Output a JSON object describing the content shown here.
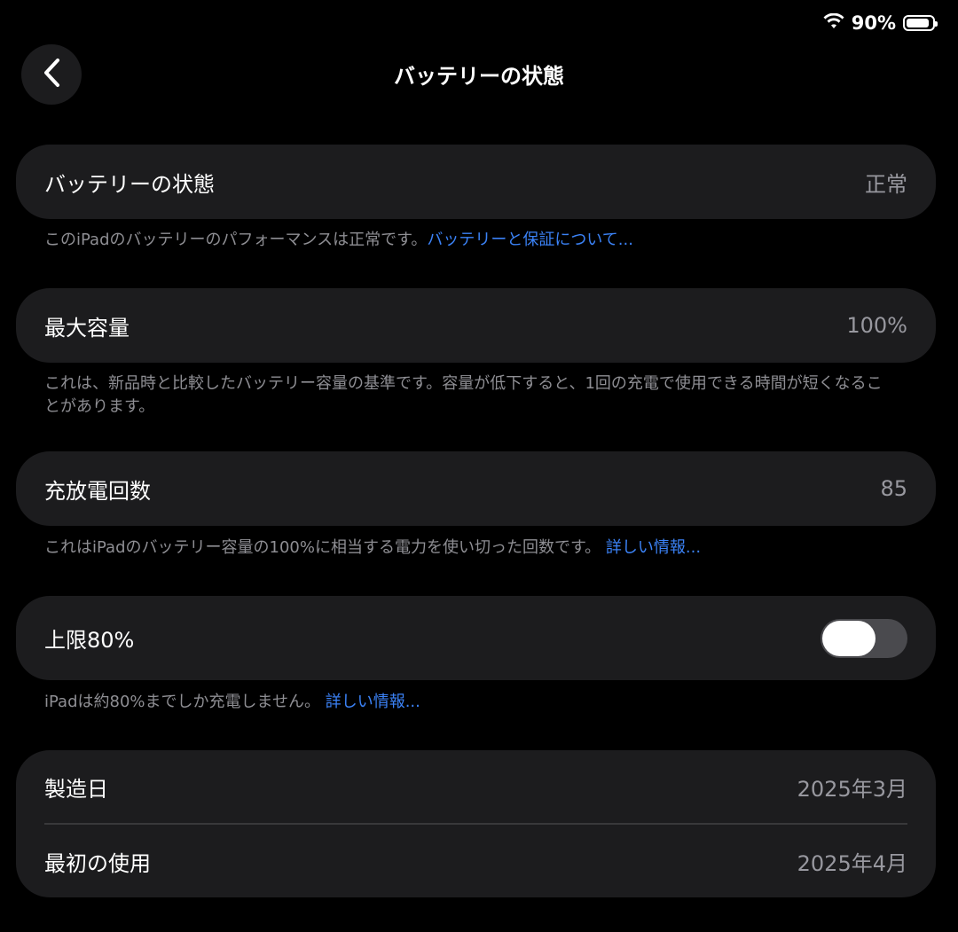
{
  "status": {
    "battery_percent": "90%",
    "battery_level": 0.9
  },
  "header": {
    "title": "バッテリーの状態"
  },
  "health": {
    "label": "バッテリーの状態",
    "value": "正常",
    "note": "このiPadのバッテリーのパフォーマンスは正常です。",
    "link": "バッテリーと保証について..."
  },
  "capacity": {
    "label": "最大容量",
    "value": "100%",
    "note": "これは、新品時と比較したバッテリー容量の基準です。容量が低下すると、1回の充電で使用できる時間が短くなることがあります。"
  },
  "cycles": {
    "label": "充放電回数",
    "value": "85",
    "note": "これはiPadのバッテリー容量の100%に相当する電力を使い切った回数です。 ",
    "link": "詳しい情報..."
  },
  "limit": {
    "label": "上限80%",
    "toggle_on": false,
    "note": "iPadは約80%までしか充電しません。 ",
    "link": "詳しい情報..."
  },
  "dates": {
    "manufacture_label": "製造日",
    "manufacture_value": "2025年3月",
    "first_use_label": "最初の使用",
    "first_use_value": "2025年4月"
  },
  "colors": {
    "link": "#3b82f6",
    "card": "#1c1c1e",
    "background": "#000000"
  }
}
